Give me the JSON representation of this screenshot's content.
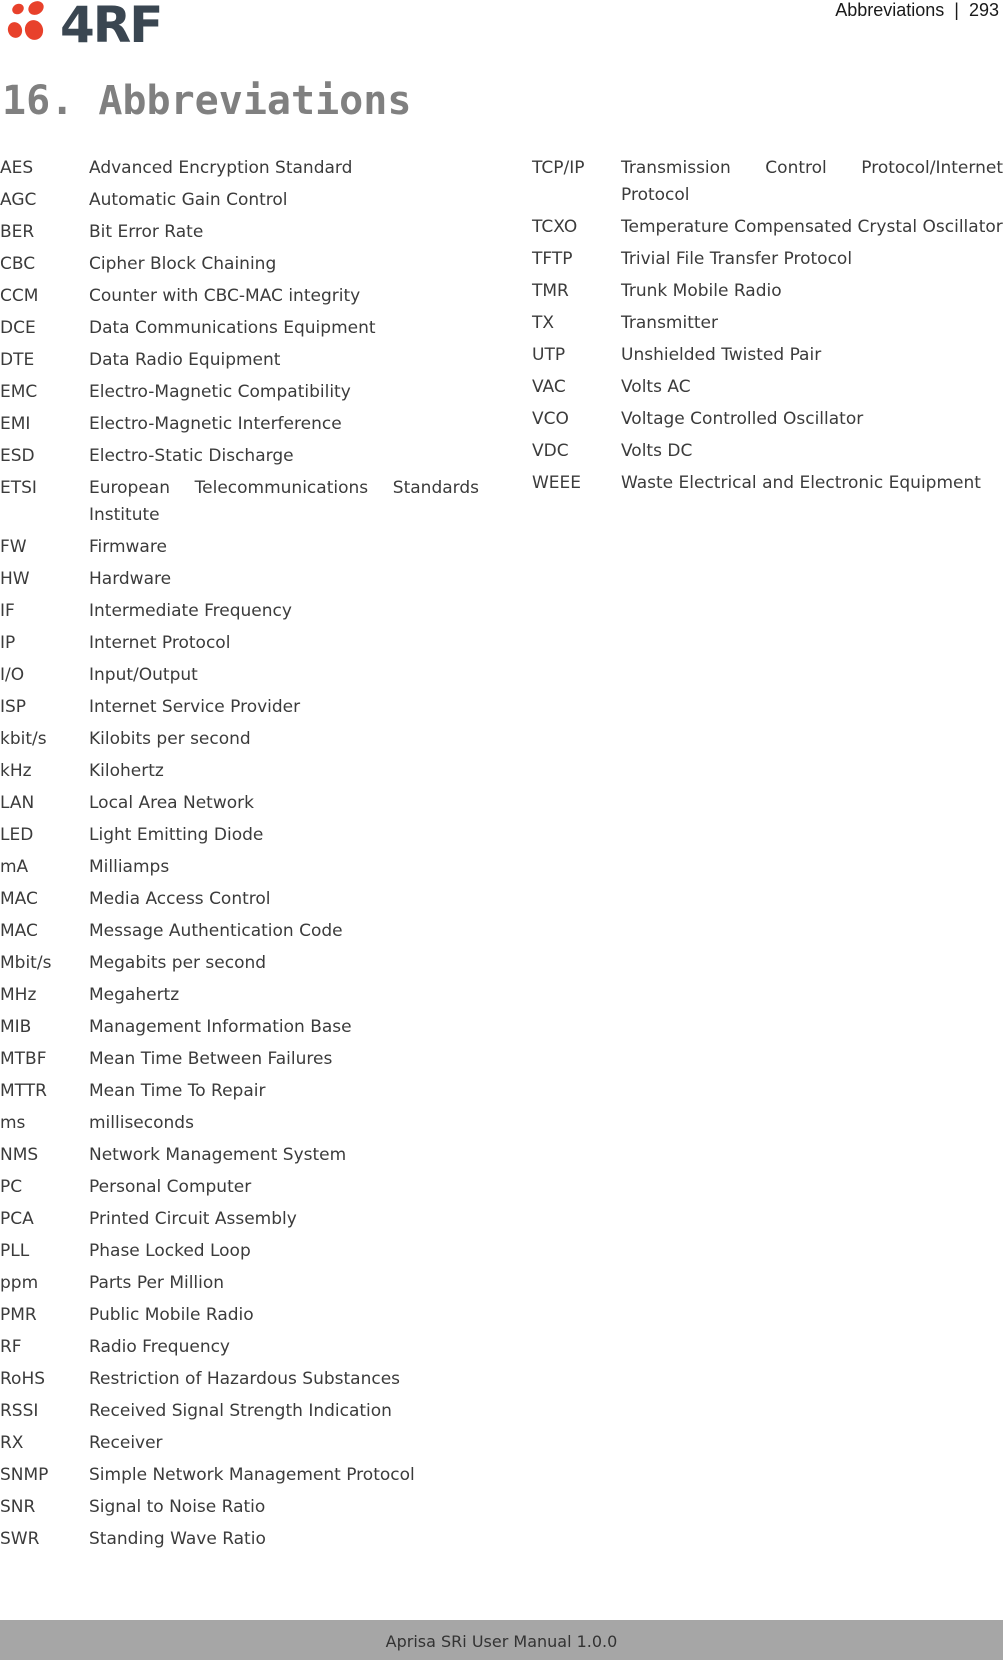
{
  "header": {
    "logo_text": "4RF",
    "running_header": "Abbreviations  |  293",
    "brand_colors": {
      "dots": "#e8412b",
      "wordmark": "#3a4651"
    }
  },
  "page_title": "16. Abbreviations",
  "abbreviations_left": [
    {
      "abbr": "AES",
      "def": "Advanced Encryption Standard"
    },
    {
      "abbr": "AGC",
      "def": "Automatic Gain Control"
    },
    {
      "abbr": "BER",
      "def": "Bit Error Rate"
    },
    {
      "abbr": "CBC",
      "def": "Cipher Block Chaining"
    },
    {
      "abbr": "CCM",
      "def": "Counter with CBC-MAC integrity"
    },
    {
      "abbr": "DCE",
      "def": "Data Communications Equipment"
    },
    {
      "abbr": "DTE",
      "def": "Data Radio Equipment"
    },
    {
      "abbr": "EMC",
      "def": "Electro-Magnetic Compatibility"
    },
    {
      "abbr": "EMI",
      "def": "Electro-Magnetic Interference"
    },
    {
      "abbr": "ESD",
      "def": "Electro-Static Discharge"
    },
    {
      "abbr": "ETSI",
      "def": "European Telecommunications Standards Institute"
    },
    {
      "abbr": "FW",
      "def": "Firmware"
    },
    {
      "abbr": "HW",
      "def": "Hardware"
    },
    {
      "abbr": "IF",
      "def": "Intermediate Frequency"
    },
    {
      "abbr": "IP",
      "def": "Internet Protocol"
    },
    {
      "abbr": "I/O",
      "def": "Input/Output"
    },
    {
      "abbr": "ISP",
      "def": "Internet Service Provider"
    },
    {
      "abbr": "kbit/s",
      "def": "Kilobits per second"
    },
    {
      "abbr": "kHz",
      "def": "Kilohertz"
    },
    {
      "abbr": "LAN",
      "def": "Local Area Network"
    },
    {
      "abbr": "LED",
      "def": "Light Emitting Diode"
    },
    {
      "abbr": "mA",
      "def": "Milliamps"
    },
    {
      "abbr": "MAC",
      "def": "Media Access Control"
    },
    {
      "abbr": "MAC",
      "def": "Message Authentication Code"
    },
    {
      "abbr": "Mbit/s",
      "def": "Megabits per second"
    },
    {
      "abbr": "MHz",
      "def": "Megahertz"
    },
    {
      "abbr": "MIB",
      "def": "Management Information Base"
    },
    {
      "abbr": "MTBF",
      "def": "Mean Time Between Failures"
    },
    {
      "abbr": "MTTR",
      "def": "Mean Time To Repair"
    },
    {
      "abbr": "ms",
      "def": "milliseconds"
    },
    {
      "abbr": "NMS",
      "def": "Network Management System"
    },
    {
      "abbr": "PC",
      "def": "Personal Computer"
    },
    {
      "abbr": "PCA",
      "def": "Printed Circuit Assembly"
    },
    {
      "abbr": "PLL",
      "def": "Phase Locked Loop"
    },
    {
      "abbr": "ppm",
      "def": "Parts Per Million"
    },
    {
      "abbr": "PMR",
      "def": "Public Mobile Radio"
    },
    {
      "abbr": "RF",
      "def": "Radio Frequency"
    },
    {
      "abbr": "RoHS",
      "def": "Restriction of Hazardous Substances"
    },
    {
      "abbr": "RSSI",
      "def": "Received Signal Strength Indication"
    },
    {
      "abbr": "RX",
      "def": "Receiver"
    },
    {
      "abbr": "SNMP",
      "def": "Simple Network Management Protocol"
    },
    {
      "abbr": "SNR",
      "def": "Signal to Noise Ratio"
    },
    {
      "abbr": "SWR",
      "def": "Standing Wave Ratio"
    }
  ],
  "abbreviations_right": [
    {
      "abbr": "TCP/IP",
      "def": "Transmission Control Protocol/Internet Protocol"
    },
    {
      "abbr": "TCXO",
      "def": "Temperature Compensated Crystal Oscillator"
    },
    {
      "abbr": "TFTP",
      "def": "Trivial File Transfer Protocol"
    },
    {
      "abbr": "TMR",
      "def": "Trunk Mobile Radio"
    },
    {
      "abbr": "TX",
      "def": "Transmitter"
    },
    {
      "abbr": "UTP",
      "def": "Unshielded Twisted Pair"
    },
    {
      "abbr": "VAC",
      "def": "Volts AC"
    },
    {
      "abbr": "VCO",
      "def": "Voltage Controlled Oscillator"
    },
    {
      "abbr": "VDC",
      "def": "Volts DC"
    },
    {
      "abbr": "WEEE",
      "def": "Waste Electrical and Electronic Equipment"
    }
  ],
  "footer": {
    "text": "Aprisa SRi User Manual 1.0.0"
  }
}
